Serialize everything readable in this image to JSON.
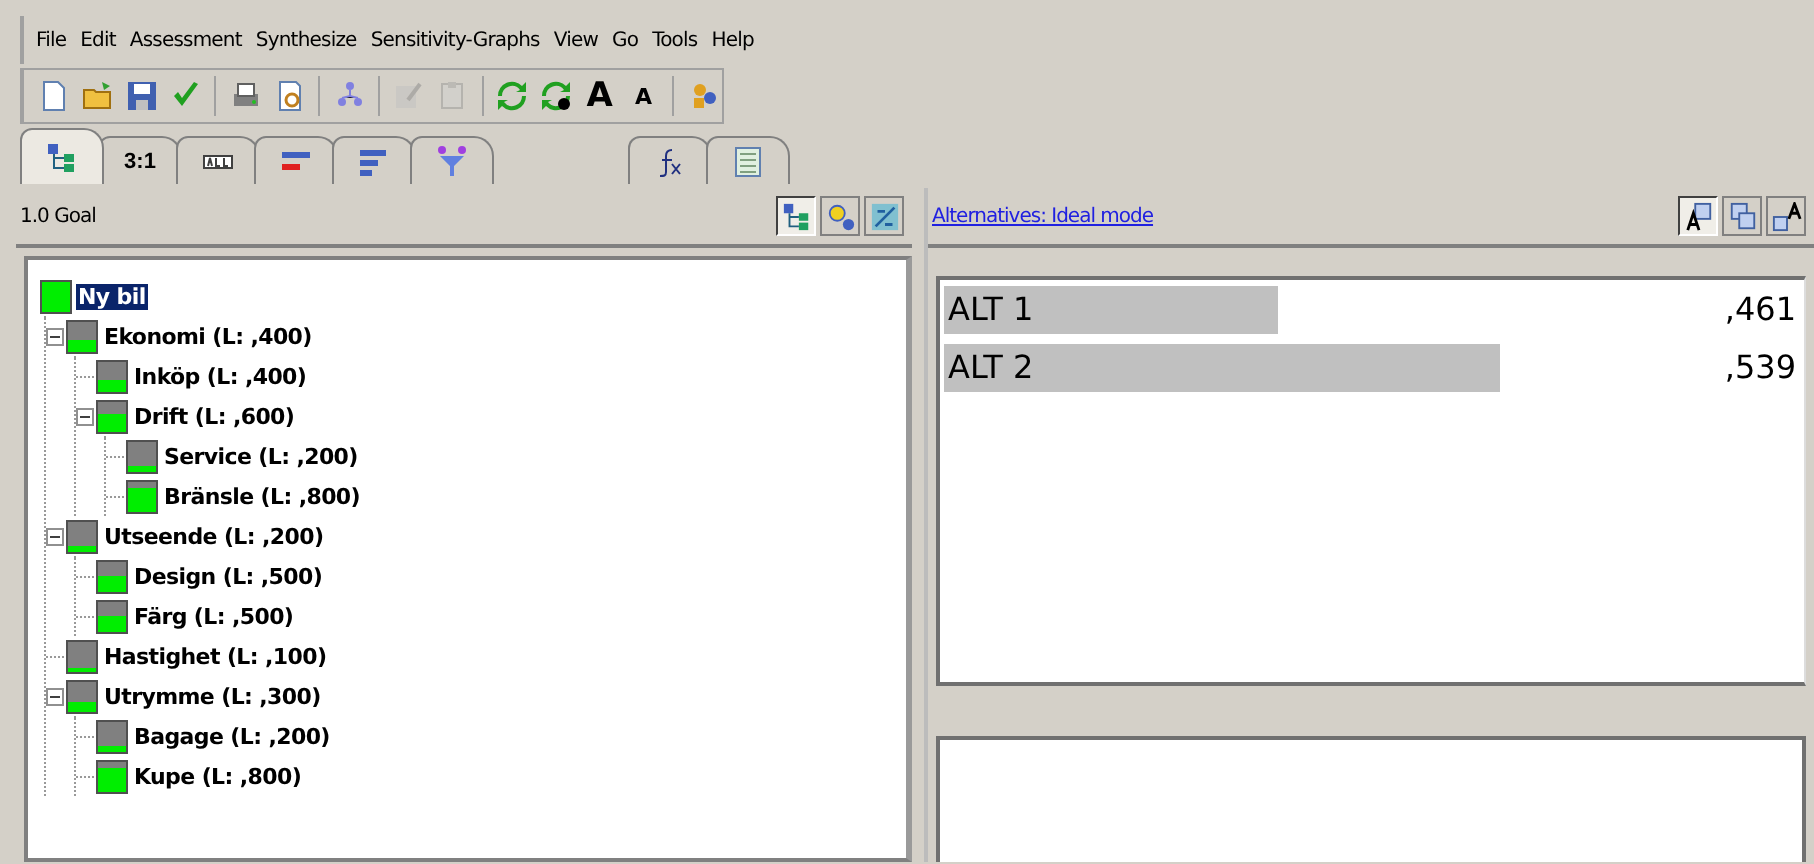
{
  "menu": [
    "File",
    "Edit",
    "Assessment",
    "Synthesize",
    "Sensitivity-Graphs",
    "View",
    "Go",
    "Tools",
    "Help"
  ],
  "toolbar": [
    {
      "kind": "new",
      "disabled": false
    },
    {
      "kind": "open",
      "disabled": false
    },
    {
      "kind": "save",
      "disabled": false
    },
    {
      "kind": "check",
      "disabled": false
    },
    {
      "kind": "sep"
    },
    {
      "kind": "print",
      "disabled": false
    },
    {
      "kind": "preview",
      "disabled": false
    },
    {
      "kind": "sep"
    },
    {
      "kind": "node",
      "disabled": false
    },
    {
      "kind": "sep"
    },
    {
      "kind": "edit",
      "disabled": true
    },
    {
      "kind": "paste",
      "disabled": true
    },
    {
      "kind": "sep"
    },
    {
      "kind": "recycle",
      "disabled": false
    },
    {
      "kind": "recycle-dot",
      "disabled": false
    },
    {
      "kind": "glyph-big",
      "label": "A",
      "disabled": false
    },
    {
      "kind": "glyph-small",
      "label": "A",
      "disabled": false
    },
    {
      "kind": "sep"
    },
    {
      "kind": "people",
      "disabled": false
    }
  ],
  "tabs": [
    {
      "kind": "tree",
      "selected": true
    },
    {
      "kind": "text",
      "label": "3:1",
      "selected": false
    },
    {
      "kind": "abc",
      "selected": false
    },
    {
      "kind": "bars-red",
      "selected": false
    },
    {
      "kind": "bars-blue",
      "selected": false
    },
    {
      "kind": "funnel",
      "selected": false
    },
    {
      "kind": "gap"
    },
    {
      "kind": "fx",
      "selected": false
    },
    {
      "kind": "sheet",
      "selected": false
    }
  ],
  "left_pane": {
    "title": "1.0 Goal",
    "buttons": [
      {
        "kind": "tree",
        "selected": true
      },
      {
        "kind": "nodes",
        "selected": false
      },
      {
        "kind": "sort",
        "selected": false
      }
    ],
    "tree": [
      {
        "label": "Ny bil",
        "level": 1,
        "selected": true,
        "children": [
          {
            "label": "Ekonomi (L: ,400)",
            "level": 0.4,
            "selected": false,
            "expanded": true,
            "children": [
              {
                "label": "Inköp (L: ,400)",
                "level": 0.4,
                "selected": false
              },
              {
                "label": "Drift (L: ,600)",
                "level": 0.6,
                "selected": false,
                "expanded": true,
                "children": [
                  {
                    "label": "Service (L: ,200)",
                    "level": 0.2,
                    "selected": false
                  },
                  {
                    "label": "Bränsle (L: ,800)",
                    "level": 0.8,
                    "selected": false
                  }
                ]
              }
            ]
          },
          {
            "label": "Utseende (L: ,200)",
            "level": 0.2,
            "selected": false,
            "expanded": true,
            "children": [
              {
                "label": "Design (L: ,500)",
                "level": 0.5,
                "selected": false
              },
              {
                "label": "Färg (L: ,500)",
                "level": 0.5,
                "selected": false
              }
            ]
          },
          {
            "label": "Hastighet (L: ,100)",
            "level": 0.1,
            "selected": false
          },
          {
            "label": "Utrymme (L: ,300)",
            "level": 0.3,
            "selected": false,
            "expanded": true,
            "children": [
              {
                "label": "Bagage (L: ,200)",
                "level": 0.2,
                "selected": false
              },
              {
                "label": "Kupe (L: ,800)",
                "level": 0.8,
                "selected": false
              }
            ]
          }
        ]
      }
    ]
  },
  "right_pane": {
    "link": "Alternatives: Ideal mode",
    "buttons": [
      {
        "kind": "ideal",
        "selected": true
      },
      {
        "kind": "distributive",
        "selected": false
      },
      {
        "kind": "raise",
        "selected": false
      }
    ],
    "alternatives": [
      {
        "name": "ALT 1",
        "level": 0.39,
        "value": ",461"
      },
      {
        "name": "ALT 2",
        "level": 0.65,
        "value": ",539"
      }
    ]
  }
}
